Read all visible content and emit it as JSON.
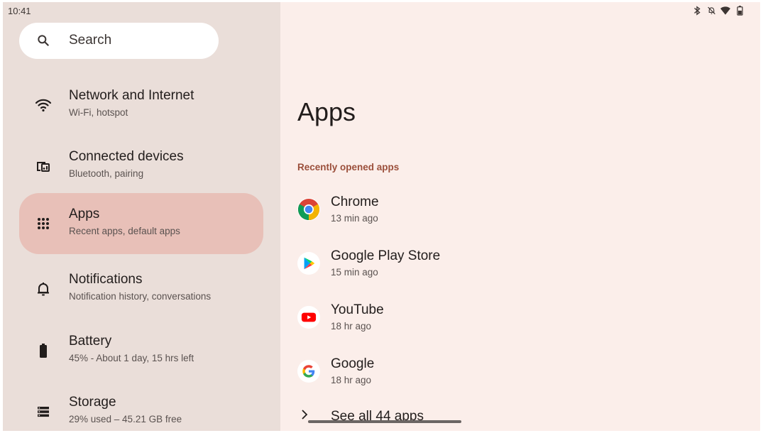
{
  "status_bar": {
    "time": "10:41",
    "icons": [
      "bluetooth-icon",
      "notifications-off-icon",
      "wifi-icon",
      "battery-icon"
    ]
  },
  "search": {
    "label": "Search",
    "icon": "search-icon"
  },
  "sidebar": {
    "items": [
      {
        "title": "Network and Internet",
        "subtitle": "Wi-Fi, hotspot",
        "icon": "wifi-icon",
        "selected": false
      },
      {
        "title": "Connected devices",
        "subtitle": "Bluetooth, pairing",
        "icon": "connected-devices-icon",
        "selected": false
      },
      {
        "title": "Apps",
        "subtitle": "Recent apps, default apps",
        "icon": "apps-grid-icon",
        "selected": true
      },
      {
        "title": "Notifications",
        "subtitle": "Notification history, conversations",
        "icon": "bell-icon",
        "selected": false
      },
      {
        "title": "Battery",
        "subtitle": "45% - About 1 day, 15 hrs left",
        "icon": "battery-icon",
        "selected": false
      },
      {
        "title": "Storage",
        "subtitle": "29% used – 45.21 GB free",
        "icon": "storage-icon",
        "selected": false
      }
    ]
  },
  "main": {
    "title": "Apps",
    "section_header": "Recently opened apps",
    "apps": [
      {
        "name": "Chrome",
        "time": "13 min ago",
        "icon": "chrome-icon"
      },
      {
        "name": "Google Play Store",
        "time": "15 min ago",
        "icon": "play-store-icon"
      },
      {
        "name": "YouTube",
        "time": "18 hr ago",
        "icon": "youtube-icon"
      },
      {
        "name": "Google",
        "time": "18 hr ago",
        "icon": "google-icon"
      }
    ],
    "see_all": "See all 44 apps"
  },
  "colors": {
    "sidebar_bg": "#eaded9",
    "main_bg": "#fbeeea",
    "selected_bg": "#e8c0b8",
    "accent": "#9b4f3b"
  }
}
